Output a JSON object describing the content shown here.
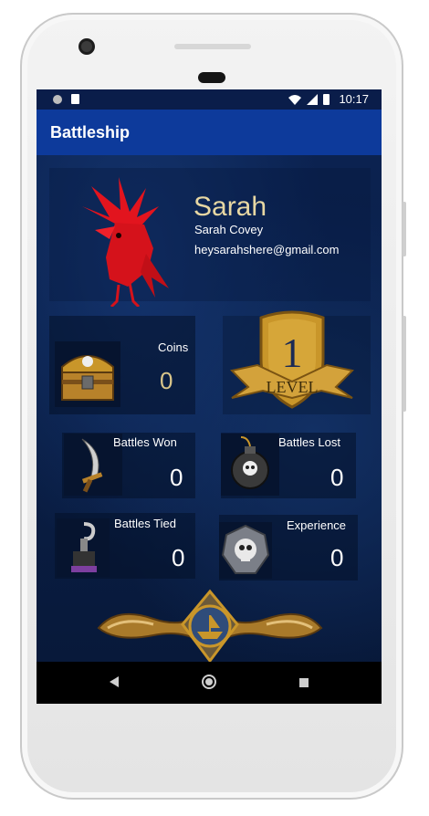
{
  "statusbar": {
    "time": "10:17"
  },
  "appbar": {
    "title": "Battleship"
  },
  "profile": {
    "name": "Sarah",
    "full_name": "Sarah Covey",
    "email": "heysarahshere@gmail.com"
  },
  "level": {
    "number": "1",
    "label": "LEVEL"
  },
  "stats": {
    "coins_label": "Coins",
    "coins_value": "0",
    "won_label": "Battles Won",
    "won_value": "0",
    "lost_label": "Battles Lost",
    "lost_value": "0",
    "tied_label": "Battles Tied",
    "tied_value": "0",
    "xp_label": "Experience",
    "xp_value": "0"
  },
  "icons": {
    "avatar": "red-bird-icon",
    "coins": "treasure-chest-icon",
    "won": "sword-icon",
    "lost": "bomb-icon",
    "tied": "hook-icon",
    "xp": "skull-icon",
    "emblem": "ship-emblem-icon"
  },
  "colors": {
    "appbar": "#0d3a9b",
    "statusbar": "#0a1d4a",
    "name": "#e7d7a3",
    "coins_value": "#d9c58a",
    "gold": "#c9962a"
  }
}
